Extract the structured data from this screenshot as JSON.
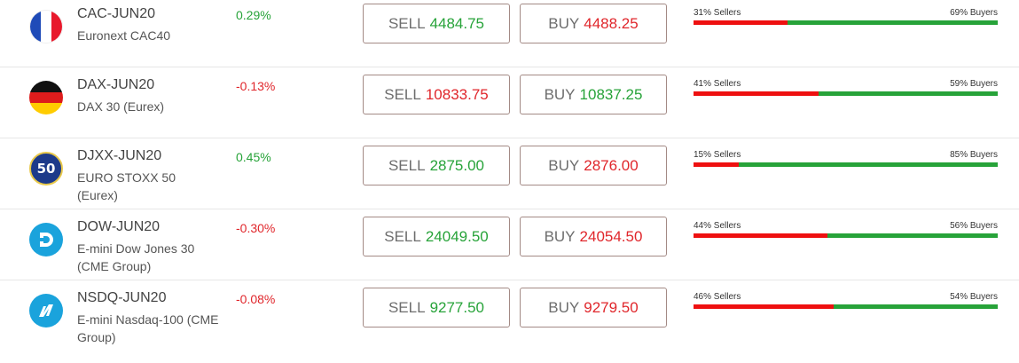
{
  "instruments": [
    {
      "name": "CAC-JUN20",
      "description": "Euronext CAC40",
      "change": "0.29%",
      "direction": "up",
      "flag": "france-flag-icon",
      "sell_label": "SELL",
      "sell_price": "4484.75",
      "sell_color": "up",
      "buy_label": "BUY",
      "buy_price": "4488.25",
      "buy_color": "down",
      "sellers_text": "31% Sellers",
      "buyers_text": "69% Buyers",
      "sellers_pct": 31
    },
    {
      "name": "DAX-JUN20",
      "description": "DAX 30 (Eurex)",
      "change": "-0.13%",
      "direction": "down",
      "flag": "germany-flag-icon",
      "sell_label": "SELL",
      "sell_price": "10833.75",
      "sell_color": "down",
      "buy_label": "BUY",
      "buy_price": "10837.25",
      "buy_color": "up",
      "sellers_text": "41% Sellers",
      "buyers_text": "59% Buyers",
      "sellers_pct": 41
    },
    {
      "name": "DJXX-JUN20",
      "description": "EURO STOXX 50 (Eurex)",
      "change": "0.45%",
      "direction": "up",
      "flag": "eurostoxx50-icon",
      "flag_text": "50",
      "sell_label": "SELL",
      "sell_price": "2875.00",
      "sell_color": "up",
      "buy_label": "BUY",
      "buy_price": "2876.00",
      "buy_color": "down",
      "sellers_text": "15% Sellers",
      "buyers_text": "85% Buyers",
      "sellers_pct": 15
    },
    {
      "name": "DOW-JUN20",
      "description": "E-mini Dow Jones 30 (CME Group)",
      "change": "-0.30%",
      "direction": "down",
      "flag": "dow-logo-icon",
      "sell_label": "SELL",
      "sell_price": "24049.50",
      "sell_color": "up",
      "buy_label": "BUY",
      "buy_price": "24054.50",
      "buy_color": "down",
      "sellers_text": "44% Sellers",
      "buyers_text": "56% Buyers",
      "sellers_pct": 44
    },
    {
      "name": "NSDQ-JUN20",
      "description": "E-mini Nasdaq-100 (CME Group)",
      "change": "-0.08%",
      "direction": "down",
      "flag": "nasdaq-logo-icon",
      "sell_label": "SELL",
      "sell_price": "9277.50",
      "sell_color": "up",
      "buy_label": "BUY",
      "buy_price": "9279.50",
      "buy_color": "down",
      "sellers_text": "46% Sellers",
      "buyers_text": "54% Buyers",
      "sellers_pct": 46
    }
  ],
  "colors": {
    "up": "#27a339",
    "down": "#e0262b",
    "sellers_bar": "#ee1010",
    "buyers_bar": "#27a339"
  }
}
